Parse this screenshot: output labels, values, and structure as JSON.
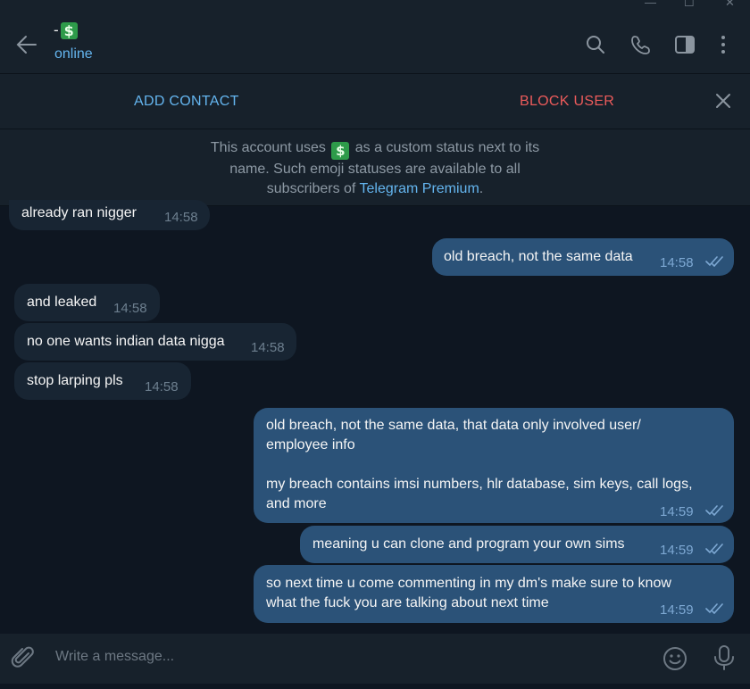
{
  "window": {
    "minimize_icon": "minimize-icon",
    "maximize_icon": "maximize-icon",
    "close_icon": "close-icon"
  },
  "header": {
    "chat_name": "-",
    "status_emoji": "$",
    "status": "online",
    "icons": [
      "search-icon",
      "phone-icon",
      "sidebar-icon",
      "more-icon"
    ]
  },
  "action_bar": {
    "add_contact": "ADD CONTACT",
    "block_user": "BLOCK USER"
  },
  "premium_notice": {
    "text_before": "This account uses ",
    "emoji": "$",
    "text_after": " as a custom status next to its name. Such emoji statuses are available to all subscribers of ",
    "link": "Telegram Premium",
    "end": "."
  },
  "messages": [
    {
      "dir": "in",
      "text": "already ran nigger",
      "time": "14:58"
    },
    {
      "dir": "out",
      "text": "old breach, not the same data",
      "time": "14:58"
    },
    {
      "dir": "in",
      "text": "and leaked",
      "time": "14:58"
    },
    {
      "dir": "in",
      "text": "no one wants indian data nigga",
      "time": "14:58"
    },
    {
      "dir": "in",
      "text": "stop larping pls",
      "time": "14:58"
    },
    {
      "dir": "out",
      "text": "old breach, not the same data, that data only involved user/\nemployee info\n\nmy breach contains imsi numbers, hlr database, sim keys, call logs,\nand more",
      "time": "14:59"
    },
    {
      "dir": "out",
      "text": "meaning u can clone and program your own sims",
      "time": "14:59"
    },
    {
      "dir": "out",
      "text": "so next time u come commenting in my dm's make sure to know\nwhat the fuck you are talking about next time",
      "time": "14:59"
    }
  ],
  "composer": {
    "placeholder": "Write a message...",
    "icons": [
      "attach-icon",
      "emoji-icon",
      "mic-icon"
    ]
  },
  "colors": {
    "background": "#0e1621",
    "panel": "#17212b",
    "incoming": "#182533",
    "outgoing": "#2b5278",
    "accent": "#64b5ef",
    "danger": "#ec5b5b"
  }
}
